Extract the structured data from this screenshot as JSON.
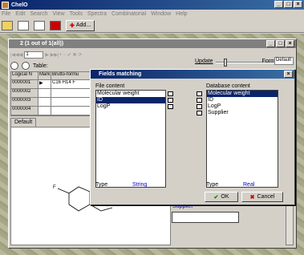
{
  "app": {
    "title": "ChelO"
  },
  "menu": [
    "File",
    "Edit",
    "Search",
    "View",
    "Tools",
    "Spectra",
    "Combinatorial",
    "Window",
    "Help"
  ],
  "toolbar": {
    "add_label": "Add..."
  },
  "child": {
    "title": "2 (1 out of 1(all))",
    "record_field": "1",
    "update_label": "Update",
    "form_label": "Form",
    "form_value": "Default",
    "table_label": "Table:",
    "grid": {
      "headers": [
        "Logical N",
        "Mark",
        "Brutto-formu"
      ],
      "rows": [
        [
          "0000001",
          "▶",
          "C16 H14 F"
        ],
        [
          "0000002",
          "",
          ""
        ],
        [
          "0000003",
          "",
          ""
        ],
        [
          "0000004",
          "",
          ""
        ]
      ]
    },
    "subtab": "Default",
    "supplier_label": "Supplier"
  },
  "dialog": {
    "title": "Fields matching",
    "file_content_label": "File content",
    "db_content_label": "Database content",
    "file_items": [
      "Molecular weight",
      "ID",
      "LogP"
    ],
    "file_selected": 1,
    "db_items": [
      "Molecular weight",
      "ID",
      "LogP",
      "Supplier"
    ],
    "db_selected": 0,
    "type_label_left": "Type",
    "type_value_left": "String",
    "type_label_right": "Type",
    "type_value_right": "Real",
    "ok_label": "OK",
    "cancel_label": "Cancel"
  },
  "icons": {
    "app": "chelo-app-icon",
    "ok": "checkmark-icon",
    "cancel": "x-icon"
  }
}
